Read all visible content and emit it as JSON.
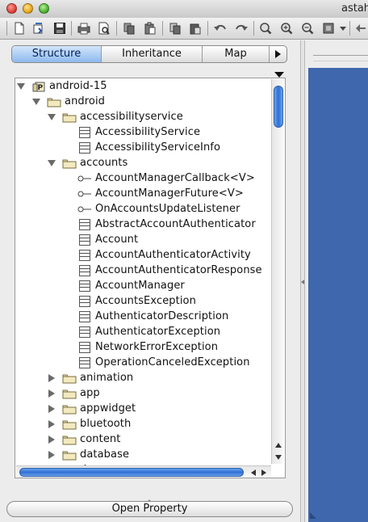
{
  "window": {
    "title": "astah"
  },
  "toolbar": {
    "icons": [
      "new-icon",
      "open-icon",
      "save-icon",
      "print-icon",
      "print-preview-icon",
      "copy-icon",
      "paste-icon",
      "copy-diagram-icon",
      "paste-diagram-icon",
      "undo-icon",
      "redo-icon",
      "zoom-icon",
      "zoom-in-icon",
      "zoom-out-icon",
      "fit-window-icon",
      "toolbar-dropdown-icon",
      "back-icon"
    ]
  },
  "tabs": [
    {
      "label": "Structure",
      "selected": true
    },
    {
      "label": "Inheritance",
      "selected": false
    },
    {
      "label": "Map",
      "selected": false
    }
  ],
  "tree": {
    "rows": [
      {
        "label": "android-15",
        "depth": 0,
        "kind": "project",
        "expanded": true
      },
      {
        "label": "android",
        "depth": 1,
        "kind": "package",
        "expanded": true
      },
      {
        "label": "accessibilityservice",
        "depth": 2,
        "kind": "package",
        "expanded": true
      },
      {
        "label": "AccessibilityService",
        "depth": 3,
        "kind": "class"
      },
      {
        "label": "AccessibilityServiceInfo",
        "depth": 3,
        "kind": "class"
      },
      {
        "label": "accounts",
        "depth": 2,
        "kind": "package",
        "expanded": true
      },
      {
        "label": "AccountManagerCallback<V>",
        "depth": 3,
        "kind": "interface"
      },
      {
        "label": "AccountManagerFuture<V>",
        "depth": 3,
        "kind": "interface"
      },
      {
        "label": "OnAccountsUpdateListener",
        "depth": 3,
        "kind": "interface"
      },
      {
        "label": "AbstractAccountAuthenticator",
        "depth": 3,
        "kind": "class"
      },
      {
        "label": "Account",
        "depth": 3,
        "kind": "class"
      },
      {
        "label": "AccountAuthenticatorActivity",
        "depth": 3,
        "kind": "class"
      },
      {
        "label": "AccountAuthenticatorResponse",
        "depth": 3,
        "kind": "class"
      },
      {
        "label": "AccountManager",
        "depth": 3,
        "kind": "class"
      },
      {
        "label": "AccountsException",
        "depth": 3,
        "kind": "class"
      },
      {
        "label": "AuthenticatorDescription",
        "depth": 3,
        "kind": "class"
      },
      {
        "label": "AuthenticatorException",
        "depth": 3,
        "kind": "class"
      },
      {
        "label": "NetworkErrorException",
        "depth": 3,
        "kind": "class"
      },
      {
        "label": "OperationCanceledException",
        "depth": 3,
        "kind": "class"
      },
      {
        "label": "animation",
        "depth": 2,
        "kind": "package",
        "expanded": false
      },
      {
        "label": "app",
        "depth": 2,
        "kind": "package",
        "expanded": false
      },
      {
        "label": "appwidget",
        "depth": 2,
        "kind": "package",
        "expanded": false
      },
      {
        "label": "bluetooth",
        "depth": 2,
        "kind": "package",
        "expanded": false
      },
      {
        "label": "content",
        "depth": 2,
        "kind": "package",
        "expanded": false
      },
      {
        "label": "database",
        "depth": 2,
        "kind": "package",
        "expanded": false
      },
      {
        "label": "d",
        "depth": 2,
        "kind": "package",
        "expanded": false
      }
    ]
  },
  "buttons": {
    "open_property": "Open Property"
  },
  "colors": {
    "selection": "#8db9ee",
    "canvas": "#3e67ad",
    "scroll_thumb": "#2f6fd6"
  }
}
